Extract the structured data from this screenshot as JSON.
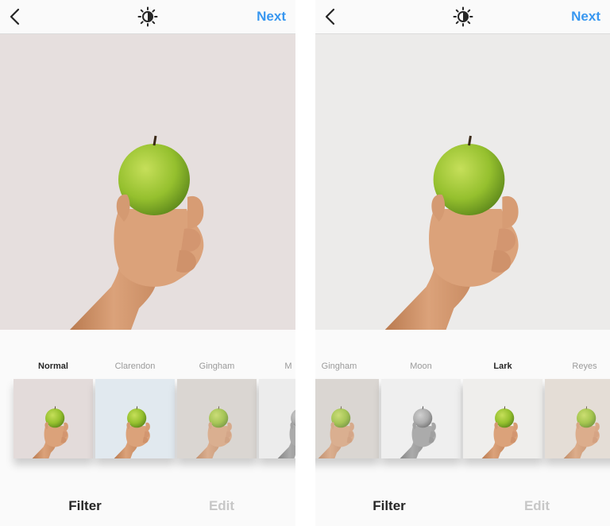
{
  "left_screen": {
    "topbar": {
      "back_icon": "chevron-left-icon",
      "brightness_icon": "lux-brightness-icon",
      "next_label": "Next"
    },
    "filters": [
      {
        "label": "Normal",
        "active": true,
        "tint": "none"
      },
      {
        "label": "Clarendon",
        "active": false,
        "tint": "cool"
      },
      {
        "label": "Gingham",
        "active": false,
        "tint": "faded"
      },
      {
        "label": "M",
        "active": false,
        "tint": "mono"
      }
    ],
    "tabs": {
      "filter": "Filter",
      "edit": "Edit"
    }
  },
  "right_screen": {
    "topbar": {
      "back_icon": "chevron-left-icon",
      "brightness_icon": "lux-brightness-icon",
      "next_label": "Next"
    },
    "filters": [
      {
        "label": "Gingham",
        "active": false,
        "tint": "faded"
      },
      {
        "label": "Moon",
        "active": false,
        "tint": "mono"
      },
      {
        "label": "Lark",
        "active": true,
        "tint": "bright"
      },
      {
        "label": "Reyes",
        "active": false,
        "tint": "warm"
      }
    ],
    "tabs": {
      "filter": "Filter",
      "edit": "Edit"
    }
  },
  "colors": {
    "accent_blue": "#3897f0",
    "active_text": "#262626",
    "inactive_text": "#9a9a9a",
    "apple_green": "#8cbd2a",
    "skin": "#d9a07a"
  }
}
